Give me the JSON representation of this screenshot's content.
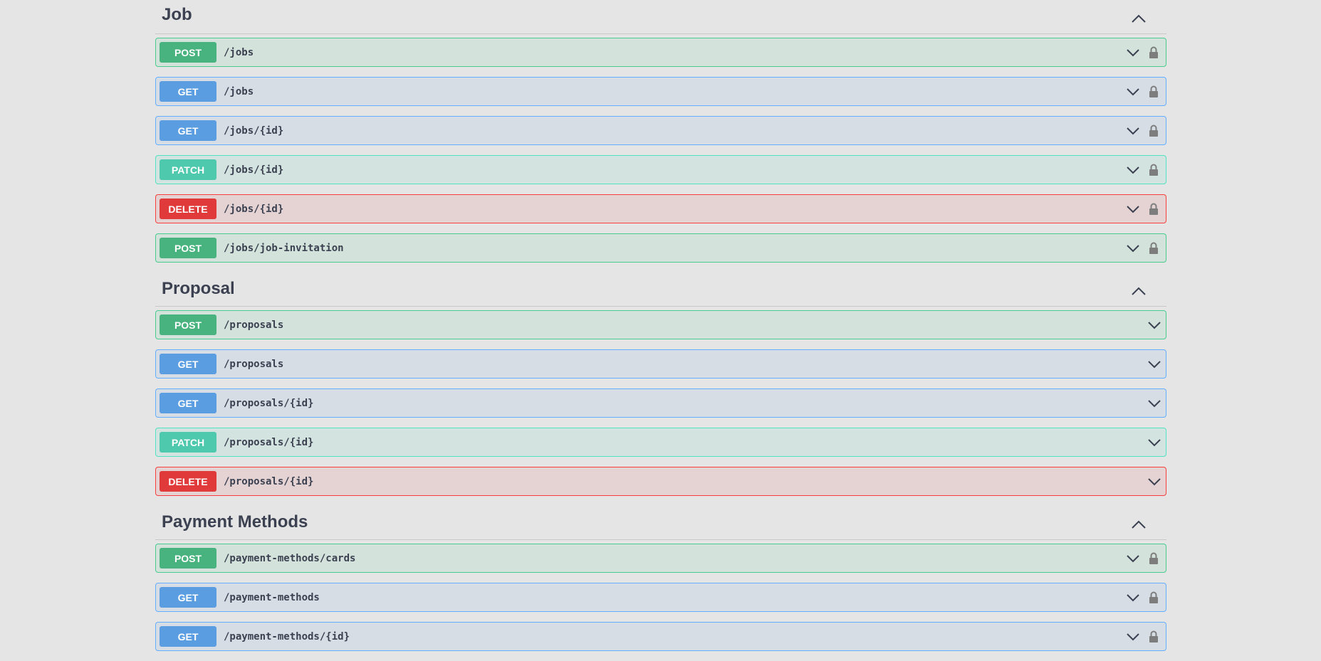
{
  "sections": [
    {
      "title": "Job",
      "operations": [
        {
          "method": "POST",
          "path": "/jobs",
          "kind": "post",
          "locked": true
        },
        {
          "method": "GET",
          "path": "/jobs",
          "kind": "get",
          "locked": true
        },
        {
          "method": "GET",
          "path": "/jobs/{id}",
          "kind": "get",
          "locked": true
        },
        {
          "method": "PATCH",
          "path": "/jobs/{id}",
          "kind": "patch",
          "locked": true
        },
        {
          "method": "DELETE",
          "path": "/jobs/{id}",
          "kind": "delete",
          "locked": true
        },
        {
          "method": "POST",
          "path": "/jobs/job-invitation",
          "kind": "post",
          "locked": true
        }
      ]
    },
    {
      "title": "Proposal",
      "operations": [
        {
          "method": "POST",
          "path": "/proposals",
          "kind": "post",
          "locked": false
        },
        {
          "method": "GET",
          "path": "/proposals",
          "kind": "get",
          "locked": false
        },
        {
          "method": "GET",
          "path": "/proposals/{id}",
          "kind": "get",
          "locked": false
        },
        {
          "method": "PATCH",
          "path": "/proposals/{id}",
          "kind": "patch",
          "locked": false
        },
        {
          "method": "DELETE",
          "path": "/proposals/{id}",
          "kind": "delete",
          "locked": false
        }
      ]
    },
    {
      "title": "Payment Methods",
      "operations": [
        {
          "method": "POST",
          "path": "/payment-methods/cards",
          "kind": "post",
          "locked": true
        },
        {
          "method": "GET",
          "path": "/payment-methods",
          "kind": "get",
          "locked": true
        },
        {
          "method": "GET",
          "path": "/payment-methods/{id}",
          "kind": "get",
          "locked": true
        }
      ]
    }
  ],
  "colors": {
    "post": "#49cc90",
    "get": "#61affe",
    "patch": "#50e3c2",
    "delete": "#f93e3e",
    "text": "#3b4151"
  },
  "icons": {
    "section_toggle": "chevron-up-icon",
    "expand": "chevron-down-icon",
    "lock": "lock-icon"
  }
}
